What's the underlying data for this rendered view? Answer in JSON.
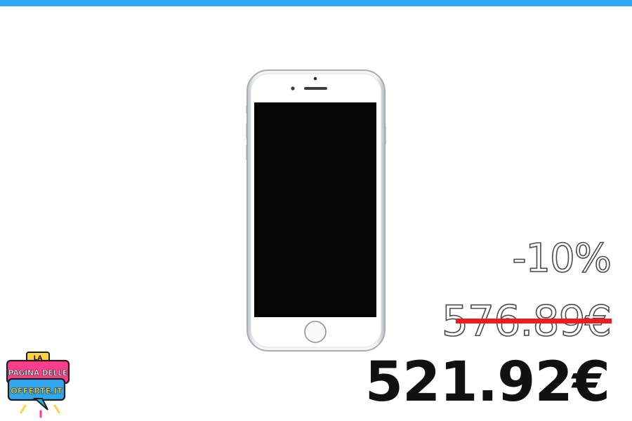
{
  "product": {
    "image_name": "smartphone-image"
  },
  "pricing": {
    "discount": "-10%",
    "old_price": "576.89€",
    "new_price": "521.92€",
    "strike_color": "#ee1c1c"
  },
  "logo": {
    "line1": "LA",
    "line2": "PAGINA DELLE",
    "line3": "OFFERTE.IT"
  },
  "colors": {
    "top_bar": "#2ea8f5",
    "logo_pink": "#ff3d8b",
    "logo_blue": "#31a6f0",
    "logo_yellow": "#ffd23f"
  }
}
